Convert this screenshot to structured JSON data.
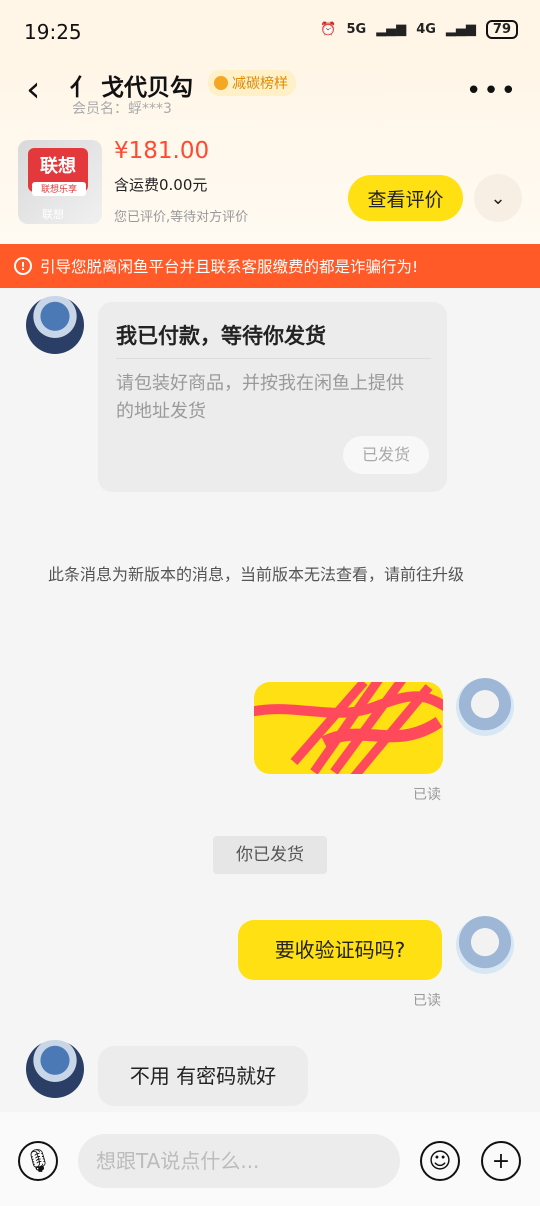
{
  "status_bar": {
    "time": "19:25",
    "network1": "5G",
    "network2": "4G",
    "battery": "79"
  },
  "header": {
    "title": "亻 戈代贝勾",
    "tag": "减碳榜样",
    "member": "会员名：蜉***3"
  },
  "product": {
    "image_logo": "联想",
    "image_sub": "联想乐享",
    "image_caption": "联想",
    "price": "¥181.00",
    "shipping": "含运费0.00元",
    "review_note": "您已评价,等待对方评价",
    "review_button": "查看评价"
  },
  "warning": "引导您脱离闲鱼平台并且联系客服缴费的都是诈骗行为!",
  "messages": {
    "card": {
      "title": "我已付款，等待你发货",
      "text": "请包装好商品，并按我在闲鱼上提供的地址发货",
      "button": "已发货"
    },
    "system_note": "此条消息为新版本的消息，当前版本无法查看，请前往升级",
    "redacted_read": "已读",
    "shipped_status": "你已发货",
    "question": "要收验证码吗?",
    "question_read": "已读",
    "reply": "不用 有密码就好"
  },
  "composer": {
    "placeholder": "想跟TA说点什么..."
  },
  "colors": {
    "accent_yellow": "#ffe012",
    "warning_orange": "#ff5a27",
    "price_red": "#ff4a32"
  }
}
